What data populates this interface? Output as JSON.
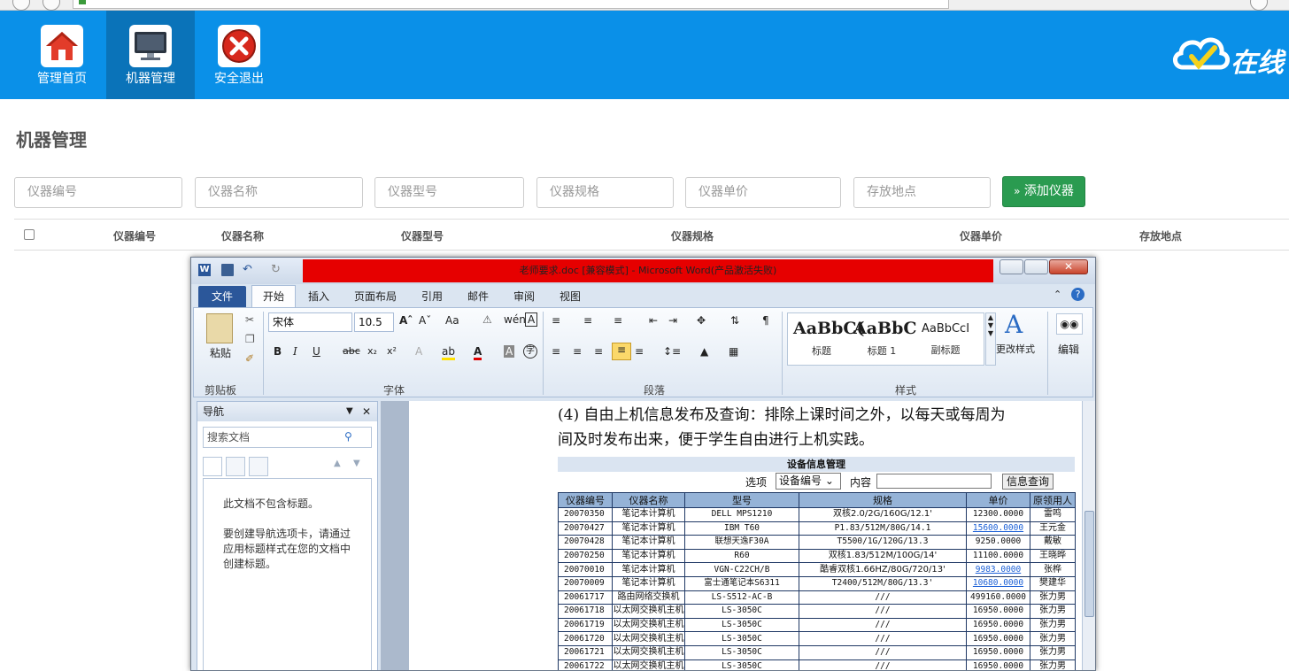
{
  "browser": {
    "url": ""
  },
  "nav": {
    "items": [
      {
        "label": "管理首页",
        "icon": "home-icon"
      },
      {
        "label": "机器管理",
        "icon": "monitor-icon",
        "active": true
      },
      {
        "label": "安全退出",
        "icon": "exit-icon"
      }
    ],
    "brand_text": "在线"
  },
  "page": {
    "title": "机器管理"
  },
  "filters": {
    "id_placeholder": "仪器编号",
    "name_placeholder": "仪器名称",
    "model_placeholder": "仪器型号",
    "spec_placeholder": "仪器规格",
    "price_placeholder": "仪器单价",
    "location_placeholder": "存放地点",
    "add_button": "添加仪器"
  },
  "table": {
    "headers": [
      "仪器编号",
      "仪器名称",
      "仪器型号",
      "仪器规格",
      "仪器单价",
      "存放地点"
    ]
  },
  "word": {
    "title": "老师要求.doc [兼容模式] - Microsoft Word(产品激活失败)",
    "tabs": [
      "文件",
      "开始",
      "插入",
      "页面布局",
      "引用",
      "邮件",
      "审阅",
      "视图"
    ],
    "font_name": "宋体",
    "font_size": "10.5",
    "group_labels": [
      "剪贴板",
      "字体",
      "段落",
      "样式"
    ],
    "paste_label": "粘贴",
    "change_styles_label": "更改样式",
    "edit_label": "编辑",
    "styles": [
      {
        "preview": "AaBbC(",
        "name": "标题"
      },
      {
        "preview": "AaBbC",
        "name": "标题 1"
      },
      {
        "preview": "AaBbCcI",
        "name": "副标题"
      }
    ],
    "nav_pane": {
      "title": "导航",
      "search_placeholder": "搜索文档",
      "line1": "此文档不包含标题。",
      "line2": "要创建导航选项卡，请通过应用标题样式在您的文档中创建标题。"
    },
    "doc_para_line1": "(4) 自由上机信息发布及查询：排除上课时间之外，以每天或每周为",
    "doc_para_line2": "间及时发布出来，便于学生自由进行上机实践。",
    "embedded": {
      "title": "设备信息管理",
      "option_label": "选项",
      "option_value": "设备编号",
      "content_label": "内容",
      "query_button": "信息查询",
      "headers": [
        "仪器编号",
        "仪器名称",
        "型号",
        "规格",
        "单价",
        "原领用人"
      ],
      "rows": [
        [
          "20070350",
          "笔记本计算机",
          "DELL MPS1210",
          "双核2.0/2G/160G/12.1'",
          "12300.0000",
          "雷鸣"
        ],
        [
          "20070427",
          "笔记本计算机",
          "IBM T60",
          "P1.83/512M/80G/14.1",
          "15600.0000",
          "王元金"
        ],
        [
          "20070428",
          "笔记本计算机",
          "联想天逸F30A",
          "T5500/1G/120G/13.3",
          "9250.0000",
          "戴敏"
        ],
        [
          "20070250",
          "笔记本计算机",
          "R60",
          "双核1.83/512M/100G/14'",
          "11100.0000",
          "王晓晔"
        ],
        [
          "20070010",
          "笔记本计算机",
          "VGN-C22CH/B",
          "酷睿双核1.66HZ/80G/720/13'",
          "9983.0000",
          "张桦"
        ],
        [
          "20070009",
          "笔记本计算机",
          "富士通笔记本S6311",
          "T2400/512M/80G/13.3'",
          "10680.0000",
          "樊建华"
        ],
        [
          "20061717",
          "路由网络交换机",
          "LS-S512-AC-B",
          "///",
          "499160.0000",
          "张力男"
        ],
        [
          "20061718",
          "以太网交换机主机",
          "LS-3050C",
          "///",
          "16950.0000",
          "张力男"
        ],
        [
          "20061719",
          "以太网交换机主机",
          "LS-3050C",
          "///",
          "16950.0000",
          "张力男"
        ],
        [
          "20061720",
          "以太网交换机主机",
          "LS-3050C",
          "///",
          "16950.0000",
          "张力男"
        ],
        [
          "20061721",
          "以太网交换机主机",
          "LS-3050C",
          "///",
          "16950.0000",
          "张力男"
        ],
        [
          "20061722",
          "以太网交换机主机",
          "LS-3050C",
          "///",
          "16950.0000",
          "张力男"
        ]
      ]
    }
  },
  "colors": {
    "nav_bg": "#0a90e8",
    "nav_active": "#0a73b9",
    "add_button": "#2a9b50",
    "word_title_bar": "#e60000"
  }
}
